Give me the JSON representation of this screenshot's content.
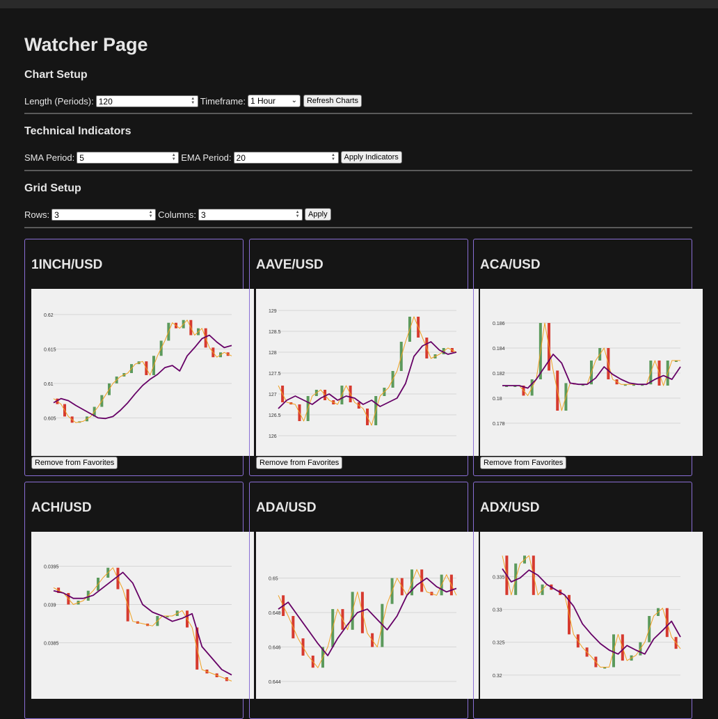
{
  "page": {
    "title": "Watcher Page"
  },
  "chart_setup": {
    "heading": "Chart Setup",
    "length_label": "Length (Periods):",
    "length_value": "120",
    "timeframe_label": "Timeframe:",
    "timeframe_value": "1 Hour",
    "refresh_label": "Refresh Charts"
  },
  "indicators": {
    "heading": "Technical Indicators",
    "sma_label": "SMA Period:",
    "sma_value": "5",
    "ema_label": "EMA Period:",
    "ema_value": "20",
    "apply_label": "Apply Indicators"
  },
  "grid_setup": {
    "heading": "Grid Setup",
    "rows_label": "Rows:",
    "rows_value": "3",
    "cols_label": "Columns:",
    "cols_value": "3",
    "apply_label": "Apply"
  },
  "remove_label": "Remove from Favorites",
  "colors": {
    "up": "#5c9a5c",
    "down": "#d63a2f",
    "sma": "#f0a020",
    "ema": "#660066",
    "border": "#8a6fd6"
  },
  "cards": [
    {
      "symbol": "1INCH/USD"
    },
    {
      "symbol": "AAVE/USD"
    },
    {
      "symbol": "ACA/USD"
    },
    {
      "symbol": "ACH/USD"
    },
    {
      "symbol": "ADA/USD"
    },
    {
      "symbol": "ADX/USD"
    }
  ],
  "chart_data": [
    {
      "type": "line",
      "ylim": [
        0.6015,
        0.6215
      ],
      "yticks": [
        "0.62",
        "0.615",
        "0.61",
        "0.605"
      ],
      "ytick_values": [
        0.62,
        0.615,
        0.61,
        0.605
      ],
      "series": [
        {
          "values": [
            0.6072,
            0.6078,
            0.6075,
            0.6068,
            0.6062,
            0.6056,
            0.605,
            0.6049,
            0.6052,
            0.6061,
            0.6072,
            0.6085,
            0.6097,
            0.6106,
            0.6113,
            0.6123,
            0.6126,
            0.6118,
            0.614,
            0.6152,
            0.6165,
            0.617,
            0.616,
            0.6152,
            0.6155
          ]
        },
        {
          "values": [
            0.6078,
            0.607,
            0.6052,
            0.6043,
            0.6045,
            0.6052,
            0.6066,
            0.6083,
            0.61,
            0.611,
            0.6115,
            0.6128,
            0.6132,
            0.6112,
            0.614,
            0.6162,
            0.6188,
            0.618,
            0.6192,
            0.617,
            0.618,
            0.6152,
            0.6138,
            0.6145,
            0.614
          ]
        }
      ]
    },
    {
      "type": "line",
      "ylim": [
        125.85,
        129.15
      ],
      "yticks": [
        "129",
        "128.5",
        "128",
        "127.5",
        "127",
        "126.5",
        "126"
      ],
      "ytick_values": [
        129,
        128.5,
        128,
        127.5,
        127,
        126.5,
        126
      ],
      "series": [
        {
          "values": [
            126.65,
            126.85,
            126.95,
            126.85,
            126.75,
            126.9,
            127.0,
            126.85,
            126.95,
            126.9,
            126.75,
            126.85,
            126.7,
            126.8,
            126.9,
            127.25,
            127.9,
            128.15,
            128.25,
            128.05,
            127.95,
            128.0
          ]
        },
        {
          "values": [
            127.2,
            126.8,
            126.75,
            126.35,
            126.95,
            127.1,
            126.85,
            126.75,
            127.2,
            126.8,
            126.65,
            126.25,
            126.95,
            127.15,
            127.55,
            128.25,
            128.85,
            128.35,
            127.85,
            127.95,
            128.1,
            128.0
          ]
        }
      ]
    },
    {
      "type": "line",
      "ylim": [
        0.1765,
        0.1875
      ],
      "yticks": [
        "0.186",
        "0.184",
        "0.182",
        "0.18",
        "0.178"
      ],
      "ytick_values": [
        0.186,
        0.184,
        0.182,
        0.18,
        0.178
      ],
      "series": [
        {
          "values": [
            0.181,
            0.181,
            0.181,
            0.1808,
            0.1815,
            0.1825,
            0.1835,
            0.1828,
            0.1812,
            0.1811,
            0.1811,
            0.1816,
            0.1825,
            0.1819,
            0.1815,
            0.1812,
            0.1811,
            0.1811,
            0.1815,
            0.1818,
            0.1815,
            0.1825
          ]
        },
        {
          "values": [
            0.181,
            0.181,
            0.181,
            0.1802,
            0.1815,
            0.186,
            0.1822,
            0.179,
            0.1812,
            0.1811,
            0.1811,
            0.183,
            0.184,
            0.1815,
            0.1811,
            0.1811,
            0.1811,
            0.1811,
            0.183,
            0.181,
            0.183,
            0.183
          ]
        }
      ]
    },
    {
      "type": "line",
      "ylim": [
        0.03795,
        0.03975
      ],
      "yticks": [
        "0.0395",
        "0.039",
        "0.0385"
      ],
      "ytick_values": [
        0.0395,
        0.039,
        0.0385
      ],
      "series": [
        {
          "values": [
            0.03918,
            0.03915,
            0.03908,
            0.03908,
            0.03912,
            0.03922,
            0.03932,
            0.03942,
            0.03928,
            0.039,
            0.0389,
            0.03885,
            0.03878,
            0.03882,
            0.03888,
            0.03845,
            0.0383,
            0.03815,
            0.03808
          ]
        },
        {
          "values": [
            0.03922,
            0.03915,
            0.039,
            0.03905,
            0.03918,
            0.03935,
            0.03948,
            0.0392,
            0.03878,
            0.03875,
            0.03872,
            0.03885,
            0.03885,
            0.03892,
            0.0387,
            0.03815,
            0.0381,
            0.03805,
            0.038
          ]
        }
      ]
    },
    {
      "type": "line",
      "ylim": [
        0.6438,
        0.6518
      ],
      "yticks": [
        "0.65",
        "0.648",
        "0.646",
        "0.644"
      ],
      "ytick_values": [
        0.65,
        0.648,
        0.646,
        0.644
      ],
      "series": [
        {
          "values": [
            0.6482,
            0.6486,
            0.6478,
            0.647,
            0.6462,
            0.6455,
            0.6465,
            0.6473,
            0.648,
            0.6482,
            0.6476,
            0.647,
            0.6478,
            0.649,
            0.6496,
            0.65,
            0.6495,
            0.6492,
            0.6494
          ]
        },
        {
          "values": [
            0.649,
            0.6478,
            0.6465,
            0.6455,
            0.6448,
            0.646,
            0.6482,
            0.647,
            0.6492,
            0.6468,
            0.646,
            0.6485,
            0.65,
            0.649,
            0.6505,
            0.6492,
            0.649,
            0.6502,
            0.649
          ]
        }
      ]
    },
    {
      "type": "line",
      "ylim": [
        0.3185,
        0.3395
      ],
      "yticks": [
        "0.335",
        "0.33",
        "0.325",
        "0.32"
      ],
      "ytick_values": [
        0.335,
        0.33,
        0.325,
        0.32
      ],
      "series": [
        {
          "values": [
            0.3362,
            0.3342,
            0.3348,
            0.336,
            0.3352,
            0.3338,
            0.333,
            0.3322,
            0.3305,
            0.3278,
            0.3262,
            0.3248,
            0.3238,
            0.3232,
            0.3245,
            0.3238,
            0.3232,
            0.3255,
            0.3268,
            0.3282,
            0.3258
          ]
        },
        {
          "values": [
            0.3382,
            0.3322,
            0.337,
            0.3382,
            0.3322,
            0.3338,
            0.333,
            0.3322,
            0.3262,
            0.3242,
            0.3228,
            0.3212,
            0.3212,
            0.3262,
            0.3222,
            0.323,
            0.325,
            0.329,
            0.3302,
            0.3258,
            0.324
          ]
        }
      ]
    }
  ]
}
